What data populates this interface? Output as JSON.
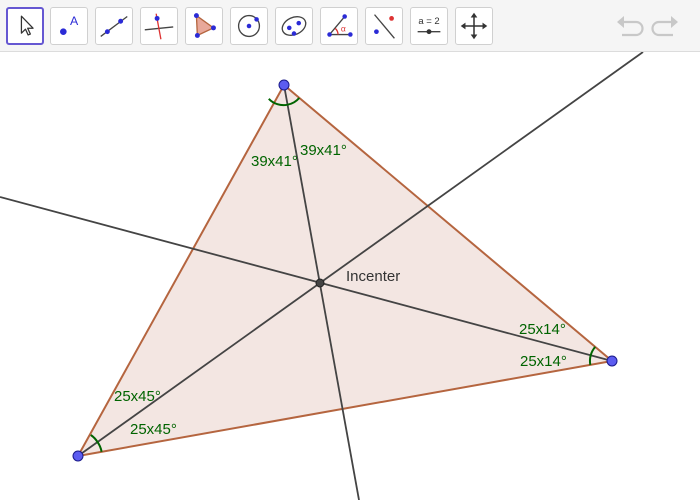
{
  "toolbar": {
    "tools": [
      {
        "name": "move",
        "icon": "cursor-arrow-icon",
        "selected": true
      },
      {
        "name": "point",
        "icon": "point-label-icon",
        "label": "A"
      },
      {
        "name": "line",
        "icon": "line-icon"
      },
      {
        "name": "perpendicular-line",
        "icon": "perpendicular-line-icon"
      },
      {
        "name": "polygon",
        "icon": "polygon-icon"
      },
      {
        "name": "circle",
        "icon": "circle-center-point-icon"
      },
      {
        "name": "conic",
        "icon": "ellipse-icon"
      },
      {
        "name": "angle",
        "icon": "angle-icon",
        "label": "α"
      },
      {
        "name": "reflect",
        "icon": "reflect-point-icon"
      },
      {
        "name": "slider",
        "icon": "slider-icon",
        "label": "a = 2"
      },
      {
        "name": "move-graphics-view",
        "icon": "move-view-icon"
      }
    ],
    "undo_icon": "undo-icon",
    "redo_icon": "redo-icon"
  },
  "canvas": {
    "incenter_label": "Incenter",
    "angle_labels": {
      "top_left": "39x41°",
      "top_right": "39x41°",
      "right_upper": "25x14°",
      "right_lower": "25x14°",
      "bottom_upper": "25x45°",
      "bottom_lower": "25x45°"
    },
    "colors": {
      "triangle_fill": "#f3e6e2",
      "triangle_edge": "#b5653f",
      "bisector": "#444444",
      "vertex": "#5c5cf0",
      "angle_arc": "#006400"
    }
  }
}
